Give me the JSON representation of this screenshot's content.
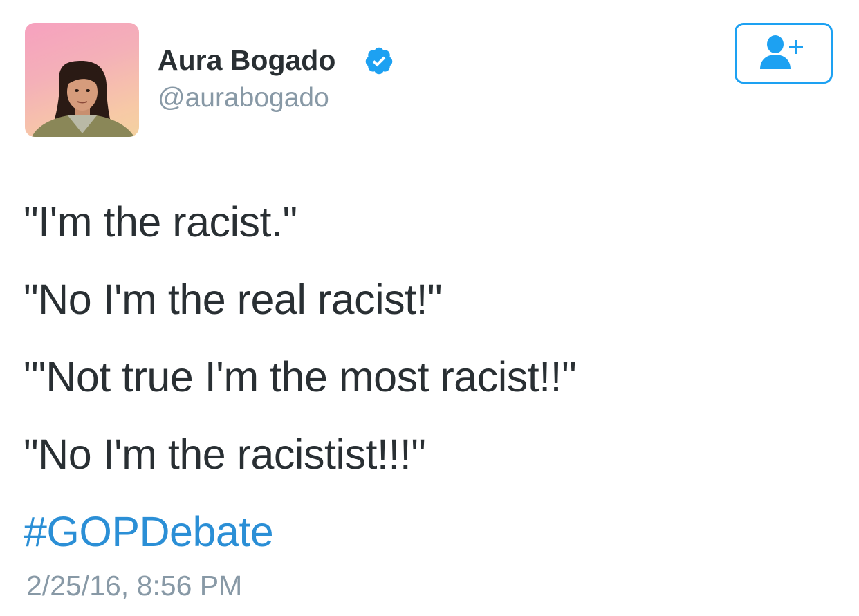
{
  "author": {
    "display_name": "Aura Bogado",
    "handle": "@aurabogado",
    "verified": true,
    "verified_icon": "verified-badge-icon",
    "avatar_icon": "profile-photo"
  },
  "follow_button": {
    "icon": "add-user-icon"
  },
  "tweet": {
    "lines": [
      "\"I'm the racist.\"",
      "\"No I'm the real racist!\"",
      "\"'Not true I'm the most racist!!\"",
      "\"No I'm the racistist!!!\""
    ],
    "hashtag": "#GOPDebate",
    "timestamp": "2/25/16, 8:56 PM"
  },
  "colors": {
    "text": "#292f33",
    "secondary": "#8899a6",
    "link": "#2b8fd6",
    "accent": "#1da1f2"
  }
}
